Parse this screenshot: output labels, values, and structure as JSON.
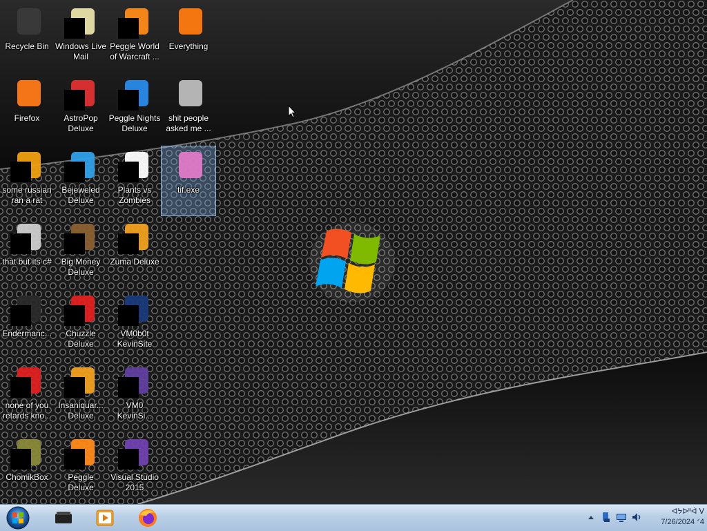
{
  "desktop": {
    "icons": [
      {
        "label": "Recycle Bin",
        "icon": "recycle-bin-icon"
      },
      {
        "label": "Windows Live Mail",
        "icon": "windows-live-mail-icon"
      },
      {
        "label": "Peggle World of Warcraft ...",
        "icon": "peggle-world-of-warcraft-icon"
      },
      {
        "label": "Everything",
        "icon": "everything-icon"
      },
      {
        "label": "Firefox",
        "icon": "firefox-icon"
      },
      {
        "label": "AstroPop Deluxe",
        "icon": "astropop-deluxe-icon"
      },
      {
        "label": "Peggle Nights Deluxe",
        "icon": "peggle-nights-deluxe-icon"
      },
      {
        "label": "shit people asked me ...",
        "icon": "folder-icon"
      },
      {
        "label": "some russian ran a rat",
        "icon": "file-icon"
      },
      {
        "label": "Bejeweled Deluxe",
        "icon": "bejeweled-deluxe-icon"
      },
      {
        "label": "Plants vs Zombies",
        "icon": "plants-vs-zombies-icon"
      },
      {
        "label": "tif.exe",
        "icon": "tif-exe-icon"
      },
      {
        "label": "that but its c#",
        "icon": "file-icon"
      },
      {
        "label": "Big Money Deluxe",
        "icon": "big-money-deluxe-icon"
      },
      {
        "label": "Zuma Deluxe",
        "icon": "zuma-deluxe-icon"
      },
      {
        "label": "Endermanc...",
        "icon": "console-icon"
      },
      {
        "label": "Chuzzle Deluxe",
        "icon": "chuzzle-deluxe-icon"
      },
      {
        "label": "VM0b0t KevinSite",
        "icon": "vm0b0t-icon"
      },
      {
        "label": "none of you retards kno...",
        "icon": "app-icon"
      },
      {
        "label": "Insaniquar... Deluxe",
        "icon": "insaniquarium-deluxe-icon"
      },
      {
        "label": "VM0 KevinSi...",
        "icon": "vm0-icon"
      },
      {
        "label": "ChomikBox",
        "icon": "chomikbox-icon"
      },
      {
        "label": "Peggle Deluxe",
        "icon": "peggle-deluxe-icon"
      },
      {
        "label": "Visual Studio 2015",
        "icon": "visual-studio-icon"
      }
    ],
    "selected_label": "tif.exe"
  },
  "taskbar": {
    "pinned": [
      {
        "icon": "device-icon"
      },
      {
        "icon": "media-player-icon"
      },
      {
        "icon": "firefox-icon"
      }
    ],
    "tray_icons": [
      "show-hidden-icons-icon",
      "tray-app-icon",
      "network-icon",
      "volume-icon"
    ],
    "clock_time": "ᐊᔭᐅᐦᐋ  ᐯ",
    "clock_date": "7/26/2024  ᐟ4"
  },
  "colors": {
    "taskbar": "#b9cfe6",
    "selection": "#78aae6"
  }
}
